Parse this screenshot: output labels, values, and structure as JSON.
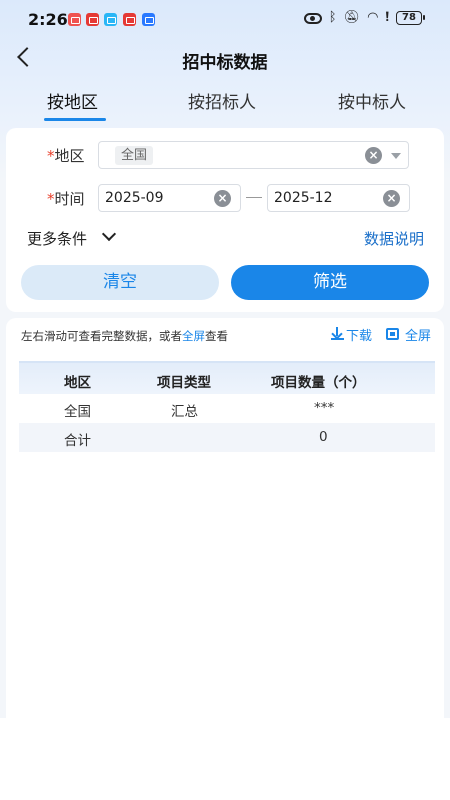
{
  "status_bar": {
    "time": "2:26",
    "battery": "78"
  },
  "nav": {
    "title": "招中标数据"
  },
  "tabs": [
    {
      "label": "按地区",
      "active": true
    },
    {
      "label": "按招标人",
      "active": false
    },
    {
      "label": "按中标人",
      "active": false
    }
  ],
  "filter": {
    "region_label": "地区",
    "region_value": "全国",
    "time_label": "时间",
    "start_date": "2025-09",
    "end_date": "2025-12",
    "more_label": "更多条件",
    "data_desc": "数据说明",
    "clear_btn": "清空",
    "filter_btn": "筛选",
    "required_mark": "*"
  },
  "results": {
    "hint_prefix": "左右滑动可查看完整数据，或者",
    "hint_link": "全屏",
    "hint_suffix": "查看",
    "download": "下载",
    "fullscreen": "全屏",
    "columns": [
      "地区",
      "项目类型",
      "项目数量（个）"
    ],
    "rows": [
      [
        "全国",
        "汇总",
        "***"
      ],
      [
        "合计",
        "",
        "0"
      ]
    ]
  },
  "colors": {
    "accent": "#1a86e8",
    "required": "#e8402c"
  }
}
